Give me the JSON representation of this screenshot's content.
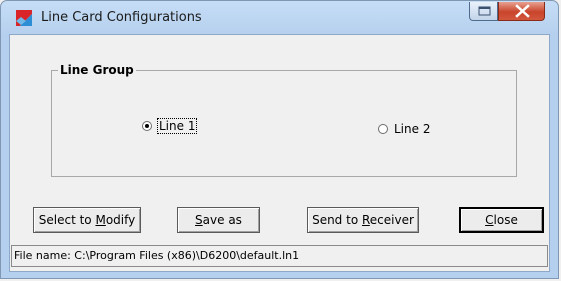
{
  "window": {
    "title": "Line Card Configurations"
  },
  "group": {
    "legend": "Line Group",
    "options": [
      {
        "label": "Line 1",
        "checked": true
      },
      {
        "label": "Line 2",
        "checked": false
      }
    ]
  },
  "buttons": {
    "select_prefix": "Select to ",
    "select_accel": "M",
    "select_rest": "odify",
    "save_accel": "S",
    "save_rest": "ave as",
    "send_prefix": "Send to ",
    "send_accel": "R",
    "send_rest": "eceiver",
    "close_accel": "C",
    "close_rest": "lose"
  },
  "status": {
    "text": "File name: C:\\Program Files (x86)\\D6200\\default.ln1"
  },
  "icons": {
    "app": "line-card-app-icon",
    "restore": "restore-icon",
    "close": "close-icon"
  }
}
